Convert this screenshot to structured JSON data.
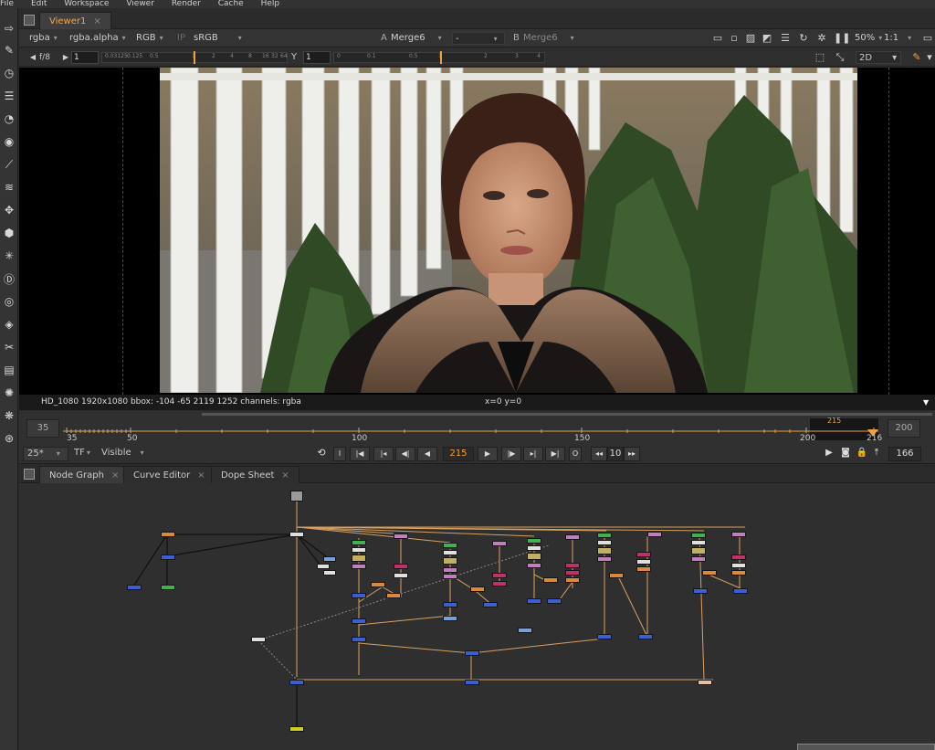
{
  "menu": [
    "File",
    "Edit",
    "Workspace",
    "Viewer",
    "Render",
    "Cache",
    "Help"
  ],
  "viewer_tab": {
    "label": "Viewer1",
    "close": "×"
  },
  "viewer_controls": {
    "channels": "rgba",
    "alpha_channel": "rgba.alpha",
    "display": "RGB",
    "ip_label": "IP",
    "lut": "sRGB",
    "input_a_label": "A",
    "input_a": "Merge6",
    "composite": "-",
    "input_b_label": "B",
    "input_b": "Merge6",
    "zoom": "50%",
    "ratio": "1:1"
  },
  "viewer_row2": {
    "fstop": "f/8",
    "gain_value": "1",
    "gain_ticks": [
      "0.03125",
      "0.125",
      "0.5",
      "1",
      "2",
      "4",
      "8",
      "16",
      "32",
      "64"
    ],
    "gamma_label": "Y",
    "gamma_value": "1",
    "gamma_ticks": [
      "0",
      "0.1",
      "0.5",
      "1",
      "2",
      "3",
      "4"
    ],
    "view_mode": "2D"
  },
  "info": {
    "format": "HD_1080 1920x1080  bbox: -104 -65 2119 1252 channels: rgba",
    "coords": "x=0 y=0"
  },
  "timeline": {
    "in_frame": "35",
    "out_frame": "200",
    "labels": [
      "35",
      "50",
      "100",
      "150",
      "200",
      "216"
    ],
    "current": "215"
  },
  "playback": {
    "fps": "25*",
    "tf": "TF",
    "visible": "Visible",
    "current_frame": "215",
    "increment": "10",
    "end_frame": "166",
    "in_btn": "I",
    "out_btn": "O"
  },
  "bottom_tabs": [
    {
      "label": "Node Graph",
      "close": "×"
    },
    {
      "label": "Curve Editor",
      "close": "×"
    },
    {
      "label": "Dope Sheet",
      "close": "×"
    }
  ],
  "colors": {
    "accent": "#f0a040",
    "node_blue": "#3b5fd0",
    "node_orange": "#d98a3a",
    "node_pink": "#c0306a",
    "node_green": "#40b050",
    "node_yellow": "#d0d020"
  }
}
